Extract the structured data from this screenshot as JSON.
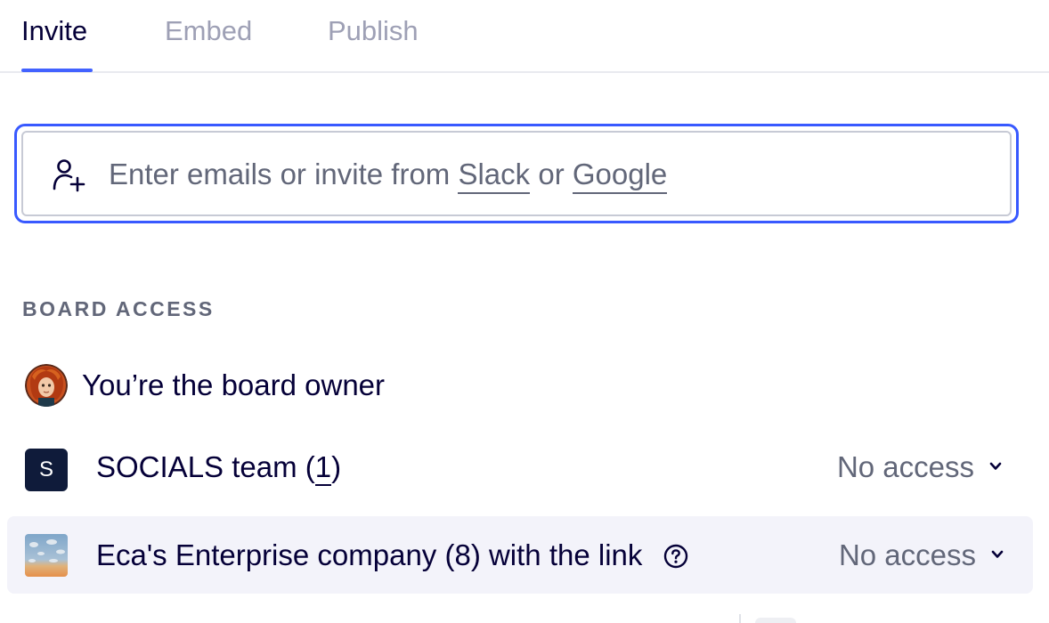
{
  "tabs": [
    {
      "label": "Invite",
      "active": true
    },
    {
      "label": "Embed",
      "active": false
    },
    {
      "label": "Publish",
      "active": false
    }
  ],
  "invite": {
    "prefix": "Enter emails or invite from ",
    "slack_link": "Slack",
    "middle": " or ",
    "google_link": "Google",
    "icon": "add-user-icon"
  },
  "board_access": {
    "header": "BOARD ACCESS",
    "owner_label": "You’re the board owner",
    "team": {
      "badge": "S",
      "name": "SOCIALS team (",
      "count": "1",
      "suffix": ")",
      "access": "No access"
    },
    "company": {
      "label": "Eca's Enterprise company (8) with the link",
      "access": "No access",
      "icon": "help-icon"
    }
  },
  "colors": {
    "accent": "#4262ff",
    "focus_border": "#3859ff",
    "text_primary": "#050038",
    "text_secondary": "#626779",
    "tab_inactive": "#9ea0b5",
    "highlight_row": "#f3f3fa",
    "team_badge": "#0f1b3a"
  }
}
